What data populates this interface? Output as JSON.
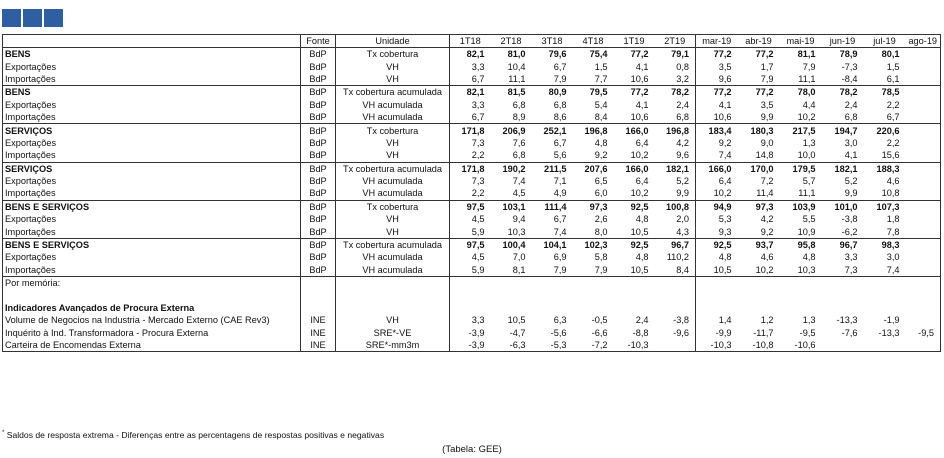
{
  "header": {
    "fonte": "Fonte",
    "unidade": "Unidade",
    "periods": [
      "1T18",
      "2T18",
      "3T18",
      "4T18",
      "1T19",
      "2T19",
      "mar-19",
      "abr-19",
      "mai-19",
      "jun-19",
      "jul-19",
      "ago-19"
    ]
  },
  "groups": [
    {
      "rows": [
        {
          "label": "BENS",
          "fonte": "BdP",
          "unidade": "Tx cobertura",
          "bold": true,
          "values": [
            "82,1",
            "81,0",
            "79,6",
            "75,4",
            "77,2",
            "79,1",
            "77,2",
            "77,2",
            "81,1",
            "78,9",
            "80,1",
            ""
          ]
        },
        {
          "label": "Exportações",
          "fonte": "BdP",
          "unidade": "VH",
          "values": [
            "3,3",
            "10,4",
            "6,7",
            "1,5",
            "4,1",
            "0,8",
            "3,5",
            "1,7",
            "7,9",
            "-7,3",
            "1,5",
            ""
          ]
        },
        {
          "label": "Importações",
          "fonte": "BdP",
          "unidade": "VH",
          "values": [
            "6,7",
            "11,1",
            "7,9",
            "7,7",
            "10,6",
            "3,2",
            "9,6",
            "7,9",
            "11,1",
            "-8,4",
            "6,1",
            ""
          ]
        }
      ]
    },
    {
      "rows": [
        {
          "label": "BENS",
          "fonte": "BdP",
          "unidade": "Tx cobertura acumulada",
          "bold": true,
          "values": [
            "82,1",
            "81,5",
            "80,9",
            "79,5",
            "77,2",
            "78,2",
            "77,2",
            "77,2",
            "78,0",
            "78,2",
            "78,5",
            ""
          ]
        },
        {
          "label": "Exportações",
          "fonte": "BdP",
          "unidade": "VH acumulada",
          "values": [
            "3,3",
            "6,8",
            "6,8",
            "5,4",
            "4,1",
            "2,4",
            "4,1",
            "3,5",
            "4,4",
            "2,4",
            "2,2",
            ""
          ]
        },
        {
          "label": "Importações",
          "fonte": "BdP",
          "unidade": "VH acumulada",
          "values": [
            "6,7",
            "8,9",
            "8,6",
            "8,4",
            "10,6",
            "6,8",
            "10,6",
            "9,9",
            "10,2",
            "6,8",
            "6,7",
            ""
          ]
        }
      ]
    },
    {
      "rows": [
        {
          "label": "SERVIÇOS",
          "fonte": "BdP",
          "unidade": "Tx cobertura",
          "bold": true,
          "values": [
            "171,8",
            "206,9",
            "252,1",
            "196,8",
            "166,0",
            "196,8",
            "183,4",
            "180,3",
            "217,5",
            "194,7",
            "220,6",
            ""
          ]
        },
        {
          "label": "Exportações",
          "fonte": "BdP",
          "unidade": "VH",
          "values": [
            "7,3",
            "7,6",
            "6,7",
            "4,8",
            "6,4",
            "4,2",
            "9,2",
            "9,0",
            "1,3",
            "3,0",
            "2,2",
            ""
          ]
        },
        {
          "label": "Importações",
          "fonte": "BdP",
          "unidade": "VH",
          "values": [
            "2,2",
            "6,8",
            "5,6",
            "9,2",
            "10,2",
            "9,6",
            "7,4",
            "14,8",
            "10,0",
            "4,1",
            "15,6",
            ""
          ]
        }
      ]
    },
    {
      "rows": [
        {
          "label": "SERVIÇOS",
          "fonte": "BdP",
          "unidade": "Tx cobertura acumulada",
          "bold": true,
          "values": [
            "171,8",
            "190,2",
            "211,5",
            "207,6",
            "166,0",
            "182,1",
            "166,0",
            "170,0",
            "179,5",
            "182,1",
            "188,3",
            ""
          ]
        },
        {
          "label": "Exportações",
          "fonte": "BdP",
          "unidade": "VH acumulada",
          "values": [
            "7,3",
            "7,4",
            "7,1",
            "6,5",
            "6,4",
            "5,2",
            "6,4",
            "7,2",
            "5,7",
            "5,2",
            "4,6",
            ""
          ]
        },
        {
          "label": "Importações",
          "fonte": "BdP",
          "unidade": "VH acumulada",
          "values": [
            "2,2",
            "4,5",
            "4,9",
            "6,0",
            "10,2",
            "9,9",
            "10,2",
            "11,4",
            "11,1",
            "9,9",
            "10,8",
            ""
          ]
        }
      ]
    },
    {
      "rows": [
        {
          "label": "BENS E SERVIÇOS",
          "fonte": "BdP",
          "unidade": "Tx cobertura",
          "bold": true,
          "values": [
            "97,5",
            "103,1",
            "111,4",
            "97,3",
            "92,5",
            "100,8",
            "94,9",
            "97,3",
            "103,9",
            "101,0",
            "107,3",
            ""
          ]
        },
        {
          "label": "Exportações",
          "fonte": "BdP",
          "unidade": "VH",
          "values": [
            "4,5",
            "9,4",
            "6,7",
            "2,6",
            "4,8",
            "2,0",
            "5,3",
            "4,2",
            "5,5",
            "-3,8",
            "1,8",
            ""
          ]
        },
        {
          "label": "Importações",
          "fonte": "BdP",
          "unidade": "VH",
          "values": [
            "5,9",
            "10,3",
            "7,4",
            "8,0",
            "10,5",
            "4,3",
            "9,3",
            "9,2",
            "10,9",
            "-6,2",
            "7,8",
            ""
          ]
        }
      ]
    },
    {
      "rows": [
        {
          "label": "BENS E SERVIÇOS",
          "fonte": "BdP",
          "unidade": "Tx cobertura acumulada",
          "bold": true,
          "values": [
            "97,5",
            "100,4",
            "104,1",
            "102,3",
            "92,5",
            "96,7",
            "92,5",
            "93,7",
            "95,8",
            "96,7",
            "98,3",
            ""
          ]
        },
        {
          "label": "Exportações",
          "fonte": "BdP",
          "unidade": "VH acumulada",
          "values": [
            "4,5",
            "7,0",
            "6,9",
            "5,8",
            "4,8",
            "110,2",
            "4,8",
            "4,6",
            "4,8",
            "3,3",
            "3,0",
            ""
          ]
        },
        {
          "label": "Importações",
          "fonte": "BdP",
          "unidade": "VH acumulada",
          "values": [
            "5,9",
            "8,1",
            "7,9",
            "7,9",
            "10,5",
            "8,4",
            "10,5",
            "10,2",
            "10,3",
            "7,3",
            "7,4",
            ""
          ]
        }
      ]
    }
  ],
  "memo": {
    "title": "Por memória:",
    "subtitle": "Indicadores Avançados de Procura Externa",
    "rows": [
      {
        "label": "Volume de Negocios na Industria - Mercado Externo (CAE Rev3)",
        "fonte": "INE",
        "unidade": "VH",
        "values": [
          "3,3",
          "10,5",
          "6,3",
          "-0,5",
          "2,4",
          "-3,8",
          "1,4",
          "1,2",
          "1,3",
          "-13,3",
          "-1,9",
          ""
        ]
      },
      {
        "label": "Inquérito à Ind. Transformadora - Procura Externa",
        "fonte": "INE",
        "unidade": "SRE*-VE",
        "values": [
          "-3,9",
          "-4,7",
          "-5,6",
          "-6,6",
          "-8,8",
          "-9,6",
          "-9,9",
          "-11,7",
          "-9,5",
          "-7,6",
          "-13,3",
          "-9,5"
        ]
      },
      {
        "label": "Carteira de Encomendas Externa",
        "fonte": "INE",
        "unidade": "SRE*-mm3m",
        "values": [
          "-3,9",
          "-6,3",
          "-5,3",
          "-7,2",
          "-10,3",
          "",
          "-10,3",
          "-10,8",
          "-10,6",
          "",
          "",
          ""
        ]
      }
    ]
  },
  "footnote": {
    "mark": "*",
    "text": "Saldos de resposta extrema - Diferenças entre as percentagens de respostas positivas e negativas"
  },
  "source": "(Tabela: GEE)",
  "colors": {
    "logo": "#2f5fa0"
  }
}
